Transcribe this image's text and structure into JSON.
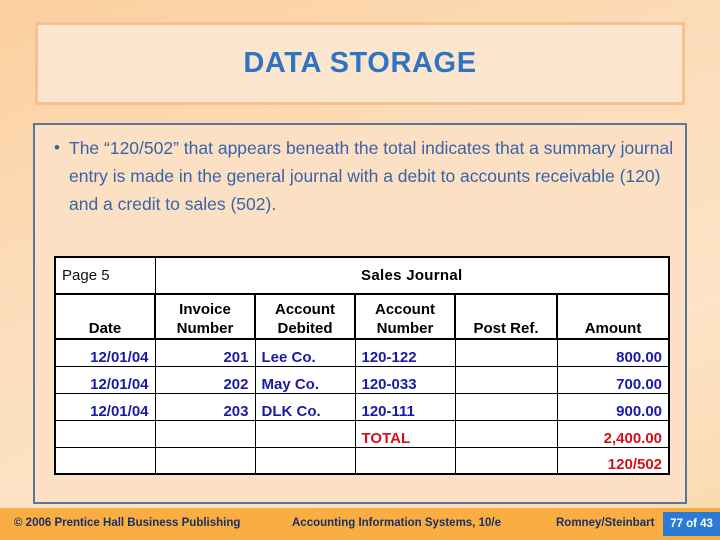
{
  "slide": {
    "title": "DATA STORAGE",
    "title_color": "#2e74c0",
    "background_color": "#fcdcb9"
  },
  "body": {
    "bullet_marker": "•",
    "bullet_text": "The “120/502” that appears beneath the total indicates that a summary journal entry is made in the general journal with a debit to accounts receivable (120) and a credit to sales (502)."
  },
  "journal": {
    "page_label": "Page 5",
    "title": "Sales Journal",
    "columns": [
      {
        "line1": "",
        "line2": "Date"
      },
      {
        "line1": "Invoice",
        "line2": "Number"
      },
      {
        "line1": "Account",
        "line2": "Debited"
      },
      {
        "line1": "Account",
        "line2": "Number"
      },
      {
        "line1": "",
        "line2": "Post Ref."
      },
      {
        "line1": "",
        "line2": "Amount"
      }
    ],
    "rows": [
      {
        "date": "12/01/04",
        "invoice_number": "201",
        "account_debited": "Lee Co.",
        "account_number": "120-122",
        "post_ref": "",
        "amount": "800.00"
      },
      {
        "date": "12/01/04",
        "invoice_number": "202",
        "account_debited": "May Co.",
        "account_number": "120-033",
        "post_ref": "",
        "amount": "700.00"
      },
      {
        "date": "12/01/04",
        "invoice_number": "203",
        "account_debited": "DLK Co.",
        "account_number": "120-111",
        "post_ref": "",
        "amount": "900.00"
      }
    ],
    "total_row": {
      "date": "",
      "invoice_number": "",
      "account_debited": "",
      "label": "TOTAL",
      "post_ref": "",
      "amount": "2,400.00"
    },
    "posting_row": {
      "date": "",
      "invoice_number": "",
      "account_debited": "",
      "account_number": "",
      "post_ref": "",
      "amount": "120/502"
    },
    "data_color": "#1a1aa8",
    "total_color": "#d4111b"
  },
  "footer": {
    "copyright": "© 2006 Prentice Hall Business Publishing",
    "book_title": "Accounting Information Systems, 10/e",
    "authors": "Romney/Steinbart",
    "page_indicator": "77 of 43",
    "band_color": "#f9ae43",
    "badge_color": "#2a7bd4"
  }
}
